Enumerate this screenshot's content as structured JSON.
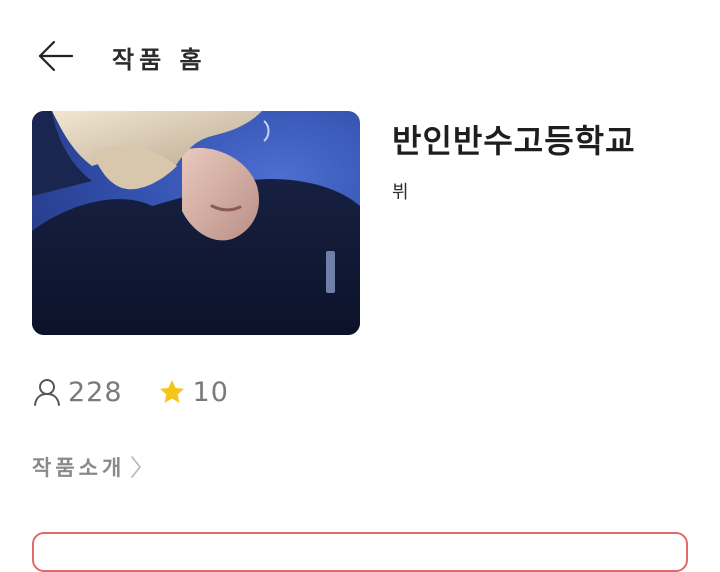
{
  "header": {
    "back_icon": "arrow-left-icon",
    "title": "작품 홈"
  },
  "work": {
    "cover_image": "cover-image-person-dark-shirt-blue-background",
    "title": "반인반수고등학교",
    "author": "뷔"
  },
  "stats": {
    "readers_icon": "user-icon",
    "readers": "228",
    "stars_icon": "star-icon",
    "stars": "10"
  },
  "intro": {
    "label": "작품소개",
    "chevron_icon": "chevron-right-icon"
  },
  "colors": {
    "star": "#f5c518",
    "accent_border": "#e06a6a",
    "muted_text": "#7a7a7a",
    "cover_background": "#3452b0"
  }
}
